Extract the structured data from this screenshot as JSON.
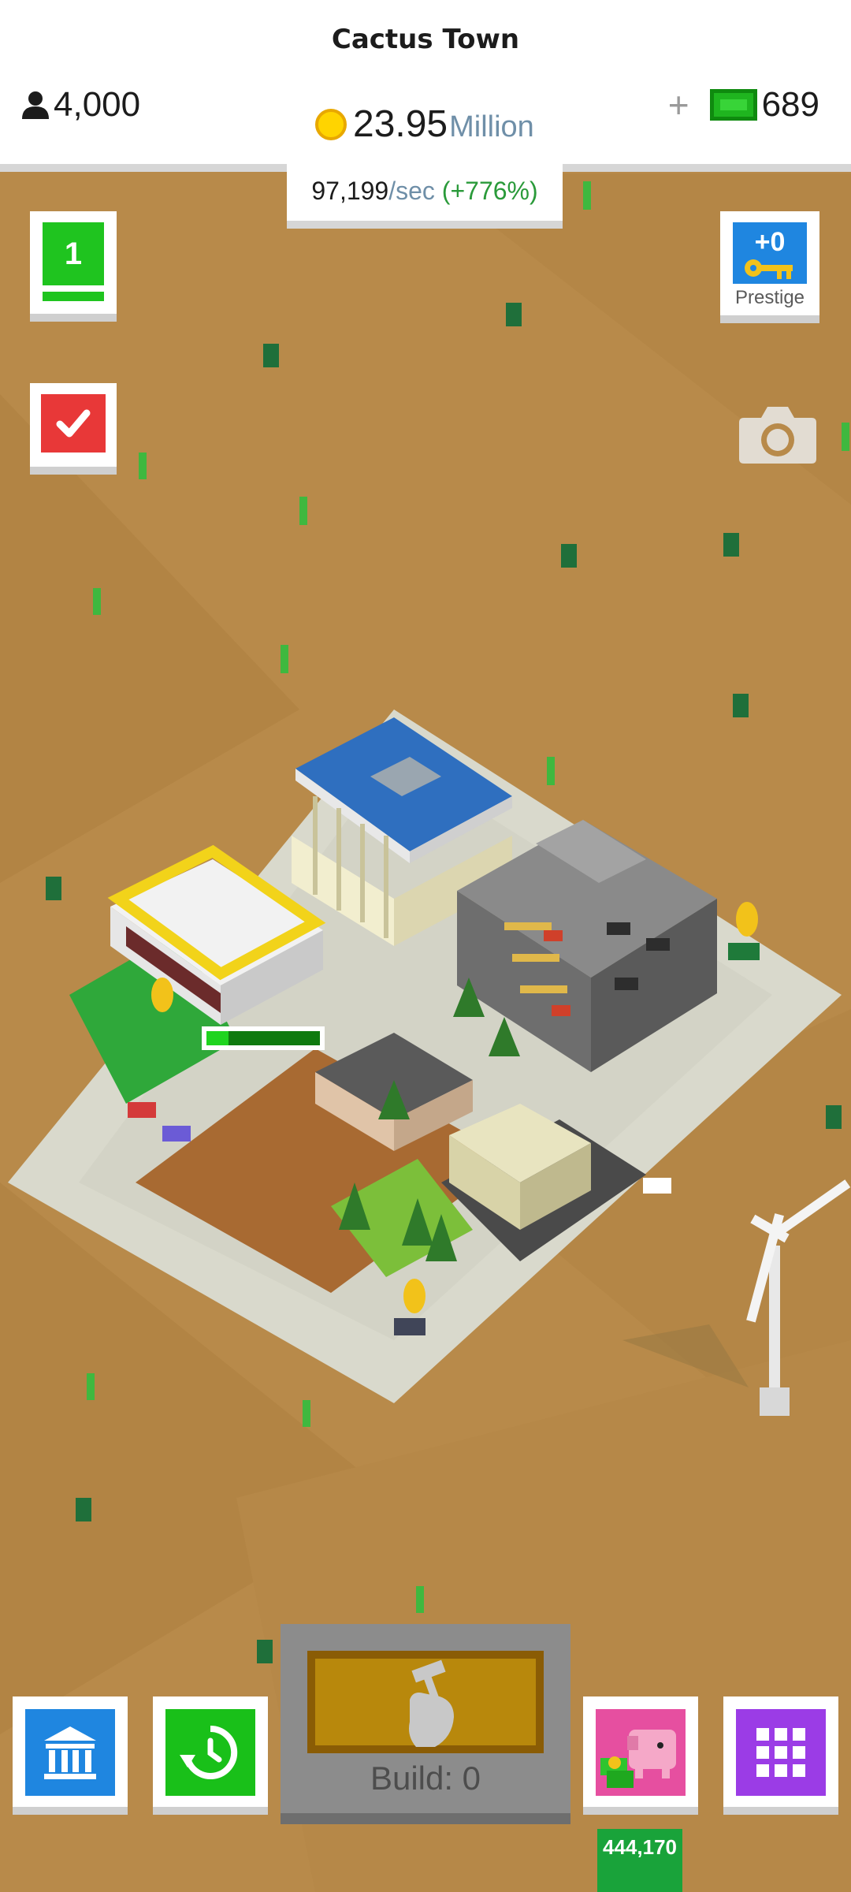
{
  "header": {
    "town_name": "Cactus Town",
    "population": "4,000",
    "population_icon": "person-icon",
    "gems_plus": "+",
    "gems": "689",
    "gems_icon": "cash-icon",
    "coins_icon": "coin-icon",
    "coins_amount": "23.95",
    "coins_unit": "Million",
    "rate_value": "97,199",
    "rate_unit": "/sec",
    "rate_bonus": "(+776%)"
  },
  "side_buttons": {
    "level": "1",
    "tasks_icon": "checkmark-icon",
    "prestige_count": "+0",
    "prestige_label": "Prestige",
    "prestige_icon": "key-icon",
    "camera_icon": "camera-icon"
  },
  "bottom_bar": {
    "bank_icon": "bank-icon",
    "history_icon": "clock-rotate-icon",
    "build_label": "Build: 0",
    "build_icon": "hammer-hand-icon",
    "savings_icon": "piggy-bank-icon",
    "savings_amount": "444,170",
    "menu_icon": "grid-icon"
  },
  "colors": {
    "desert": "#b88a4a",
    "accent_green": "#1fc41f",
    "accent_blue": "#1f86e0",
    "accent_red": "#e83838",
    "accent_purple": "#9b3ce6",
    "accent_pink": "#e64fa0"
  }
}
